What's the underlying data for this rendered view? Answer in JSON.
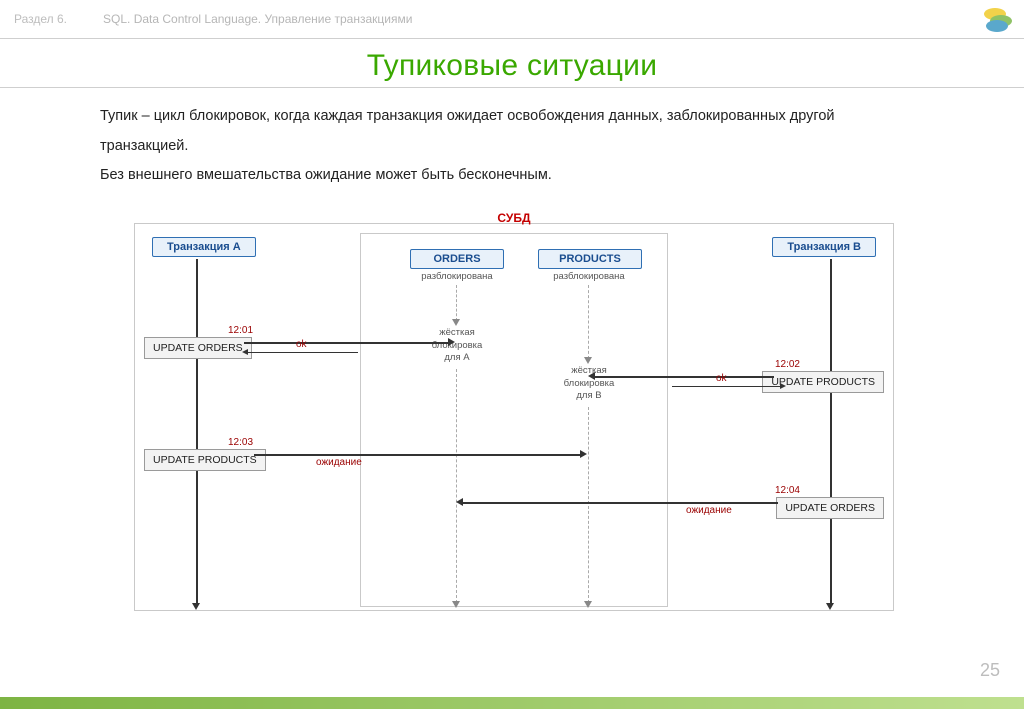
{
  "header": {
    "section": "Раздел 6.",
    "subtitle": "SQL. Data Control Language. Управление транзакциями"
  },
  "title": "Тупиковые ситуации",
  "intro": {
    "p1": "Тупик – цикл блокировок, когда каждая транзакция ожидает освобождения данных, заблокированных другой транзакцией.",
    "p2": "Без внешнего вмешательства ожидание может быть бесконечным."
  },
  "diagram": {
    "subd_title": "СУБД",
    "trans_a": "Транзакция А",
    "trans_b": "Транзакция В",
    "tbl_orders": "ORDERS",
    "tbl_products": "PRODUCTS",
    "unlocked": "разблокирована",
    "lock_for_a": "жёсткая\nблокировка\nдля А",
    "lock_for_b": "жёсткая\nблокировка\nдля В",
    "a1_time": "12:01",
    "a1_label": "UPDATE ORDERS",
    "a2_time": "12:03",
    "a2_label": "UPDATE PRODUCTS",
    "b1_time": "12:02",
    "b1_label": "UPDATE PRODUCTS",
    "b2_time": "12:04",
    "b2_label": "UPDATE ORDERS",
    "ok": "ok",
    "wait": "ожидание"
  },
  "page_number": "25"
}
